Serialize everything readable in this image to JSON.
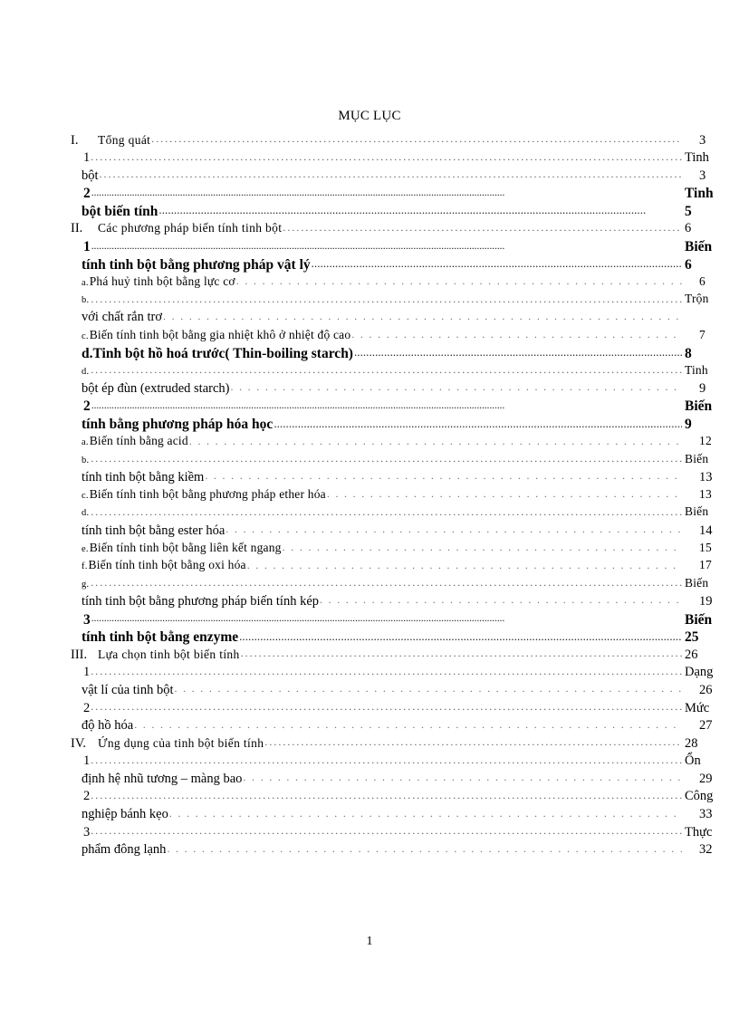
{
  "document": {
    "title": "MỤC LỤC",
    "page_number": "1"
  },
  "entries": [
    {
      "id": "e01",
      "indent": "roman",
      "marker": "I.",
      "text": "Tổng quát",
      "end": "3",
      "bold": false,
      "style": "spaced",
      "leader": "normal",
      "end_kind": "pad"
    },
    {
      "id": "e02",
      "indent": "num",
      "marker": "",
      "text": "1",
      "end": "Tinh",
      "bold": false,
      "style": "normal",
      "leader": "normal",
      "end_kind": "flush"
    },
    {
      "id": "e03",
      "indent": "cont",
      "marker": "",
      "text": "bột",
      "end": "3",
      "bold": false,
      "style": "normal",
      "leader": "normal",
      "end_kind": "pad"
    },
    {
      "id": "e04",
      "indent": "num",
      "marker": "",
      "text": "2",
      "end": "Tinh",
      "bold": true,
      "style": "normal",
      "leader": "normal",
      "end_kind": "flush"
    },
    {
      "id": "e05",
      "indent": "cont",
      "marker": "",
      "text": "bột biến tính",
      "end": "5",
      "bold": true,
      "style": "normal",
      "leader": "tight",
      "end_kind": "flush"
    },
    {
      "id": "e06",
      "indent": "roman",
      "marker": "II.",
      "text": "Các phương pháp biến tính tinh bột",
      "end": "6",
      "bold": false,
      "style": "spaced",
      "leader": "normal",
      "end_kind": "flush"
    },
    {
      "id": "e07",
      "indent": "num",
      "marker": "",
      "text": "1",
      "end": "Biến",
      "bold": true,
      "style": "normal",
      "leader": "normal",
      "end_kind": "flush"
    },
    {
      "id": "e08",
      "indent": "cont",
      "marker": "",
      "text": "tính tinh bột bằng phương pháp vật lý",
      "end": "6",
      "bold": true,
      "style": "normal",
      "leader": "tight",
      "end_kind": "flush"
    },
    {
      "id": "e09",
      "indent": "letter",
      "marker": "a.",
      "text": "Phá huỷ tinh bột bằng lực cơ",
      "end": "6",
      "bold": false,
      "style": "small",
      "leader": "sparse",
      "end_kind": "pad"
    },
    {
      "id": "e10",
      "indent": "letter",
      "marker": "b.",
      "text": "",
      "end": "Trộn",
      "bold": false,
      "style": "small",
      "leader": "normal",
      "end_kind": "flush"
    },
    {
      "id": "e11",
      "indent": "cont",
      "marker": "",
      "text": "với chất rắn trơ",
      "end": "",
      "bold": false,
      "style": "normal",
      "leader": "sparse",
      "end_kind": "pad"
    },
    {
      "id": "e12",
      "indent": "letter",
      "marker": "c.",
      "text": "Biến tính tinh bột bằng gia nhiệt khô ở nhiệt độ cao",
      "end": "7",
      "bold": false,
      "style": "small",
      "leader": "sparse",
      "end_kind": "pad"
    },
    {
      "id": "e13",
      "indent": "cont",
      "marker": "",
      "text": "d.Tinh bột hồ hoá trước( Thin-boiling starch)",
      "end": "8",
      "bold": true,
      "style": "normal",
      "leader": "tight",
      "end_kind": "flush"
    },
    {
      "id": "e14",
      "indent": "letter",
      "marker": "d.",
      "text": "",
      "end": "Tinh",
      "bold": false,
      "style": "small",
      "leader": "normal",
      "end_kind": "flush"
    },
    {
      "id": "e15",
      "indent": "cont",
      "marker": "",
      "text": "bột ép đùn (extruded starch)",
      "end": "9",
      "bold": false,
      "style": "normal",
      "leader": "sparse",
      "end_kind": "pad"
    },
    {
      "id": "e16",
      "indent": "num",
      "marker": "",
      "text": "2",
      "end": "Biến",
      "bold": true,
      "style": "normal",
      "leader": "normal",
      "end_kind": "flush"
    },
    {
      "id": "e17",
      "indent": "cont",
      "marker": "",
      "text": "tính bằng phương pháp hóa học",
      "end": "9",
      "bold": true,
      "style": "normal",
      "leader": "tight",
      "end_kind": "flush"
    },
    {
      "id": "e18",
      "indent": "letter",
      "marker": "a.",
      "text": "Biến tính bằng acid",
      "end": "12",
      "bold": false,
      "style": "small",
      "leader": "sparse",
      "end_kind": "pad"
    },
    {
      "id": "e19",
      "indent": "letter",
      "marker": "b.",
      "text": "",
      "end": "Biến",
      "bold": false,
      "style": "small",
      "leader": "normal",
      "end_kind": "flush"
    },
    {
      "id": "e20",
      "indent": "cont",
      "marker": "",
      "text": "tính tinh bột bằng kiềm",
      "end": "13",
      "bold": false,
      "style": "normal",
      "leader": "sparse",
      "end_kind": "pad"
    },
    {
      "id": "e21",
      "indent": "letter",
      "marker": "c.",
      "text": "Biến tính tinh bột bằng phương pháp ether hóa",
      "end": "13",
      "bold": false,
      "style": "small",
      "leader": "sparse",
      "end_kind": "pad"
    },
    {
      "id": "e22",
      "indent": "letter",
      "marker": "d.",
      "text": "",
      "end": "Biến",
      "bold": false,
      "style": "small",
      "leader": "normal",
      "end_kind": "flush"
    },
    {
      "id": "e23",
      "indent": "cont",
      "marker": "",
      "text": "tính tinh bột bằng ester hóa",
      "end": "14",
      "bold": false,
      "style": "normal",
      "leader": "sparse",
      "end_kind": "pad"
    },
    {
      "id": "e24",
      "indent": "letter",
      "marker": "e.",
      "text": "Biến tính tinh bột bằng liên kết ngang",
      "end": "15",
      "bold": false,
      "style": "small",
      "leader": "sparse",
      "end_kind": "pad"
    },
    {
      "id": "e25",
      "indent": "letter",
      "marker": "f.",
      "text": "Biến tính tinh bột bằng oxi hóa",
      "end": "17",
      "bold": false,
      "style": "small",
      "leader": "sparse",
      "end_kind": "pad"
    },
    {
      "id": "e26",
      "indent": "letter",
      "marker": "g.",
      "text": "",
      "end": "Biến",
      "bold": false,
      "style": "small",
      "leader": "normal",
      "end_kind": "flush"
    },
    {
      "id": "e27",
      "indent": "cont",
      "marker": "",
      "text": "tính tinh bột bằng phương pháp biến tính kép",
      "end": "19",
      "bold": false,
      "style": "normal",
      "leader": "sparse",
      "end_kind": "pad"
    },
    {
      "id": "e28",
      "indent": "num",
      "marker": "",
      "text": "3",
      "end": "Biến",
      "bold": true,
      "style": "normal",
      "leader": "normal",
      "end_kind": "flush"
    },
    {
      "id": "e29",
      "indent": "cont",
      "marker": "",
      "text": "tính tinh bột bằng enzyme",
      "end": "25",
      "bold": true,
      "style": "normal",
      "leader": "tight",
      "end_kind": "flush"
    },
    {
      "id": "e30",
      "indent": "roman",
      "marker": "III.",
      "text": "Lựa chọn tinh bột biến tính",
      "end": "26",
      "bold": false,
      "style": "spaced",
      "leader": "normal",
      "end_kind": "flush"
    },
    {
      "id": "e31",
      "indent": "num",
      "marker": "",
      "text": "1",
      "end": "Dạng",
      "bold": false,
      "style": "normal",
      "leader": "normal",
      "end_kind": "flush"
    },
    {
      "id": "e32",
      "indent": "cont",
      "marker": "",
      "text": "vật lí của tinh bột",
      "end": "26",
      "bold": false,
      "style": "normal",
      "leader": "sparse",
      "end_kind": "pad"
    },
    {
      "id": "e33",
      "indent": "num",
      "marker": "",
      "text": "2",
      "end": "Mức",
      "bold": false,
      "style": "normal",
      "leader": "normal",
      "end_kind": "flush"
    },
    {
      "id": "e34",
      "indent": "cont",
      "marker": "",
      "text": "độ hồ hóa",
      "end": "27",
      "bold": false,
      "style": "normal",
      "leader": "sparse",
      "end_kind": "pad"
    },
    {
      "id": "e35",
      "indent": "roman",
      "marker": "IV.",
      "text": "Ứng dụng của tinh bột biến tính",
      "end": "28",
      "bold": false,
      "style": "spaced",
      "leader": "normal",
      "end_kind": "flush"
    },
    {
      "id": "e36",
      "indent": "num",
      "marker": "",
      "text": "1",
      "end": "Ổn",
      "bold": false,
      "style": "normal",
      "leader": "normal",
      "end_kind": "flush"
    },
    {
      "id": "e37",
      "indent": "cont",
      "marker": "",
      "text": "định hệ nhũ tương – màng bao",
      "end": "29",
      "bold": false,
      "style": "normal",
      "leader": "sparse",
      "end_kind": "pad"
    },
    {
      "id": "e38",
      "indent": "num",
      "marker": "",
      "text": "2",
      "end": "Công",
      "bold": false,
      "style": "normal",
      "leader": "normal",
      "end_kind": "flush"
    },
    {
      "id": "e39",
      "indent": "cont",
      "marker": "",
      "text": "nghiệp bánh kẹo",
      "end": "33",
      "bold": false,
      "style": "normal",
      "leader": "sparse",
      "end_kind": "pad"
    },
    {
      "id": "e40",
      "indent": "num",
      "marker": "",
      "text": "3",
      "end": "Thực",
      "bold": false,
      "style": "normal",
      "leader": "normal",
      "end_kind": "flush"
    },
    {
      "id": "e41",
      "indent": "cont",
      "marker": "",
      "text": "phẩm đông lạnh",
      "end": "32",
      "bold": false,
      "style": "normal",
      "leader": "sparse",
      "end_kind": "pad"
    }
  ]
}
